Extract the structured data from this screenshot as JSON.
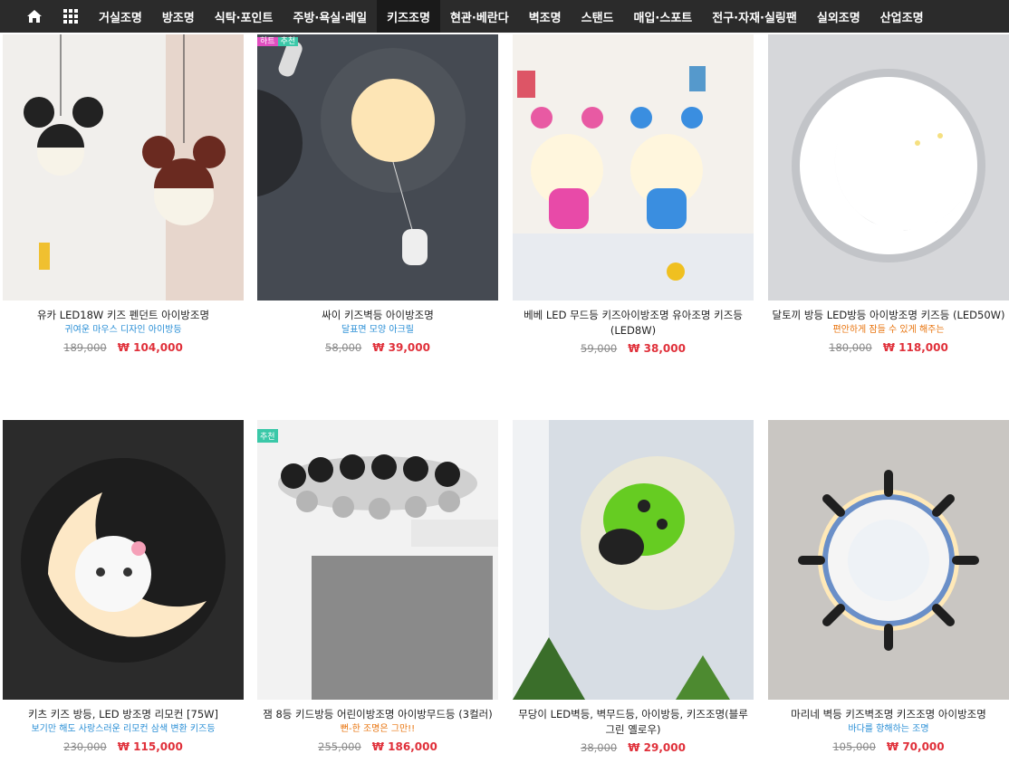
{
  "nav": {
    "items": [
      "거실조명",
      "방조명",
      "식탁·포인트",
      "주방·욕실·레일",
      "키즈조명",
      "현관·베란다",
      "벽조명",
      "스탠드",
      "매입·스포트",
      "전구·자재·실링팬",
      "실외조명",
      "산업조명"
    ],
    "active": "키즈조명"
  },
  "products": [
    {
      "title": "유카 LED18W 키즈 펜던트 아이방조명",
      "subtitle": "귀여운 마우스 디자인 아이방등",
      "old_price": "189,000",
      "price": "₩ 104,000"
    },
    {
      "title": "싸이 키즈벽등 아이방조명",
      "subtitle": "달표면 모양 아크릴",
      "old_price": "58,000",
      "price": "₩ 39,000",
      "badges": [
        "하트",
        "추천"
      ]
    },
    {
      "title": "베베 LED 무드등 키즈아이방조명 유아조명 키즈등 (LED8W)",
      "subtitle": "",
      "old_price": "59,000",
      "price": "₩ 38,000"
    },
    {
      "title": "달토끼 방등 LED방등 아이방조명 키즈등 (LED50W)",
      "subtitle": "편안하게 잠들 수 있게 해주는",
      "old_price": "180,000",
      "price": "₩ 118,000"
    },
    {
      "title": "키츠 키즈 방등, LED 방조명 리모컨 [75W]",
      "subtitle": "보기만 해도 사랑스러운 리모컨 삼색 변환 키즈등",
      "old_price": "230,000",
      "price": "₩ 115,000"
    },
    {
      "title": "잼 8등 키드방등 어린이방조명 아이방무드등 (3컬러)",
      "subtitle": "뻔-한 조명은 그만!!",
      "old_price": "255,000",
      "price": "₩ 186,000",
      "badge": "추천"
    },
    {
      "title": "무당이 LED벽등, 벽무드등, 아이방등, 키즈조명(블루 그린 옐로우)",
      "subtitle": "",
      "old_price": "38,000",
      "price": "₩ 29,000"
    },
    {
      "title": "마리네 벽등 키즈벽조명 키즈조명 아이방조명",
      "subtitle": "바다를 항해하는 조명",
      "old_price": "105,000",
      "price": "₩ 70,000"
    }
  ]
}
